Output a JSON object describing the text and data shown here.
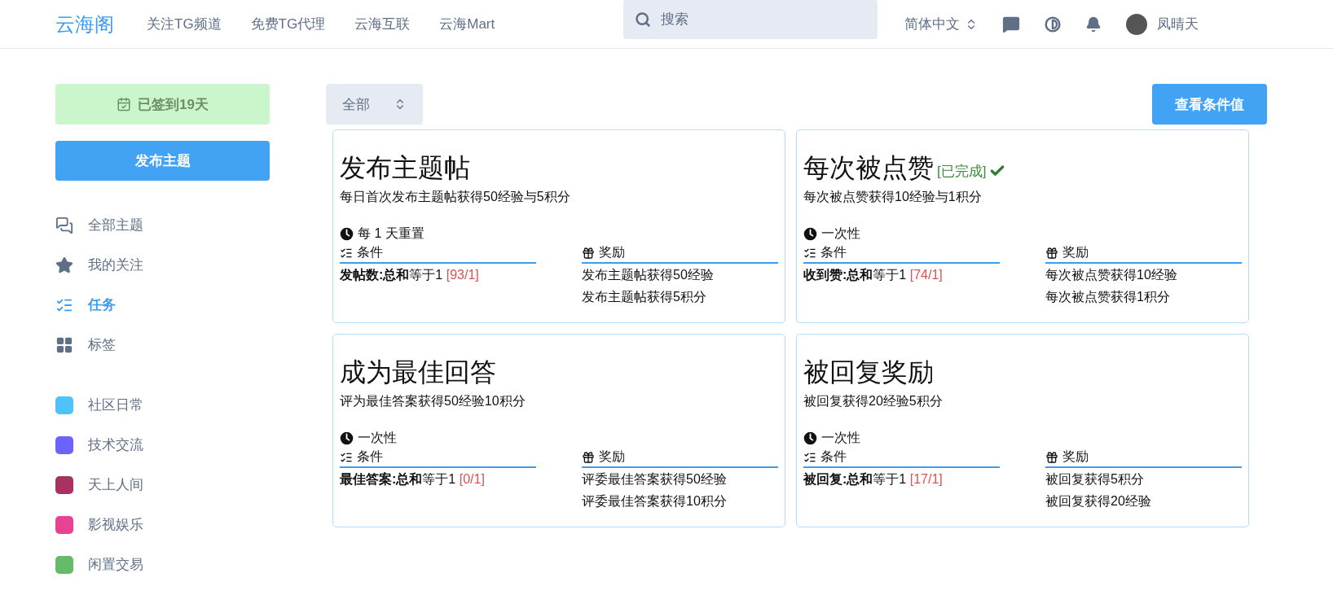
{
  "header": {
    "logo": "云海阁",
    "nav": [
      "关注TG频道",
      "免费TG代理",
      "云海互联",
      "云海Mart"
    ],
    "search": {
      "placeholder": "搜索"
    },
    "language": "简体中文",
    "user": "凤晴天"
  },
  "sidebar": {
    "checkin": "已签到19天",
    "post_button": "发布主题",
    "items": [
      {
        "kind": "chats",
        "label": "全部主题",
        "selected": false
      },
      {
        "kind": "star",
        "label": "我的关注",
        "selected": false
      },
      {
        "kind": "tasks",
        "label": "任务",
        "selected": true
      },
      {
        "kind": "grid",
        "label": "标签",
        "selected": false
      }
    ],
    "categories": [
      {
        "label": "社区日常",
        "color": "#4fc3f7"
      },
      {
        "label": "技术交流",
        "color": "#6c63ff"
      },
      {
        "label": "天上人间",
        "color": "#a83262"
      },
      {
        "label": "影视娱乐",
        "color": "#e84393"
      },
      {
        "label": "闲置交易",
        "color": "#66bb6a"
      }
    ]
  },
  "toolbar": {
    "filter": "全部",
    "view_button": "查看条件值"
  },
  "tasks": [
    {
      "title": "发布主题帖",
      "completed": false,
      "description": "每日首次发布主题帖获得50经验与5积分",
      "reset": "每 1 天重置",
      "conditions_label": "条件",
      "rewards_label": "奖励",
      "condition": "**发帖数:总和**等于1",
      "progress": "[93/1]",
      "rewards": [
        "发布主题帖获得50经验",
        "发布主题帖获得5积分"
      ]
    },
    {
      "title": "每次被点赞",
      "completed": true,
      "status": "[已完成]",
      "description": "每次被点赞获得10经验与1积分",
      "reset": "一次性",
      "conditions_label": "条件",
      "rewards_label": "奖励",
      "condition": "**收到赞:总和**等于1",
      "progress": "[74/1]",
      "rewards": [
        "每次被点赞获得10经验",
        "每次被点赞获得1积分"
      ]
    },
    {
      "title": "成为最佳回答",
      "completed": false,
      "description": "评为最佳答案获得50经验10积分",
      "reset": "一次性",
      "conditions_label": "条件",
      "rewards_label": "奖励",
      "condition": "**最佳答案:总和**等于1",
      "progress": "[0/1]",
      "rewards": [
        "评委最佳答案获得50经验",
        "评委最佳答案获得10积分"
      ]
    },
    {
      "title": "被回复奖励",
      "completed": false,
      "description": "被回复获得20经验5积分",
      "reset": "一次性",
      "conditions_label": "条件",
      "rewards_label": "奖励",
      "condition": "**被回复:总和**等于1",
      "progress": "[17/1]",
      "rewards": [
        "被回复获得5积分",
        "被回复获得20经验"
      ]
    }
  ]
}
